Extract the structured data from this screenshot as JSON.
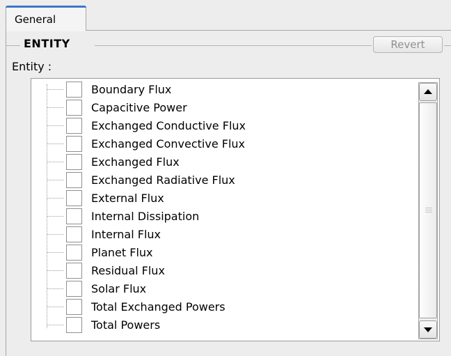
{
  "tabs": [
    {
      "label": "General",
      "active": true
    }
  ],
  "group": {
    "title": "ENTITY",
    "revert_label": "Revert"
  },
  "field": {
    "label": "Entity :"
  },
  "entities": [
    {
      "label": "Boundary Flux",
      "checked": false
    },
    {
      "label": "Capacitive Power",
      "checked": false
    },
    {
      "label": "Exchanged Conductive Flux",
      "checked": false
    },
    {
      "label": "Exchanged Convective Flux",
      "checked": false
    },
    {
      "label": "Exchanged Flux",
      "checked": false
    },
    {
      "label": "Exchanged Radiative Flux",
      "checked": false
    },
    {
      "label": "External Flux",
      "checked": false
    },
    {
      "label": "Internal Dissipation",
      "checked": false
    },
    {
      "label": "Internal Flux",
      "checked": false
    },
    {
      "label": "Planet Flux",
      "checked": false
    },
    {
      "label": "Residual Flux",
      "checked": false
    },
    {
      "label": "Solar Flux",
      "checked": false
    },
    {
      "label": "Total Exchanged Powers",
      "checked": false
    },
    {
      "label": "Total Powers",
      "checked": false
    }
  ],
  "colors": {
    "tab_accent": "#3c76c8",
    "background": "#ededed",
    "list_background": "#ffffff"
  },
  "icons": {
    "scroll_up": "arrow-up-icon",
    "scroll_down": "arrow-down-icon"
  }
}
